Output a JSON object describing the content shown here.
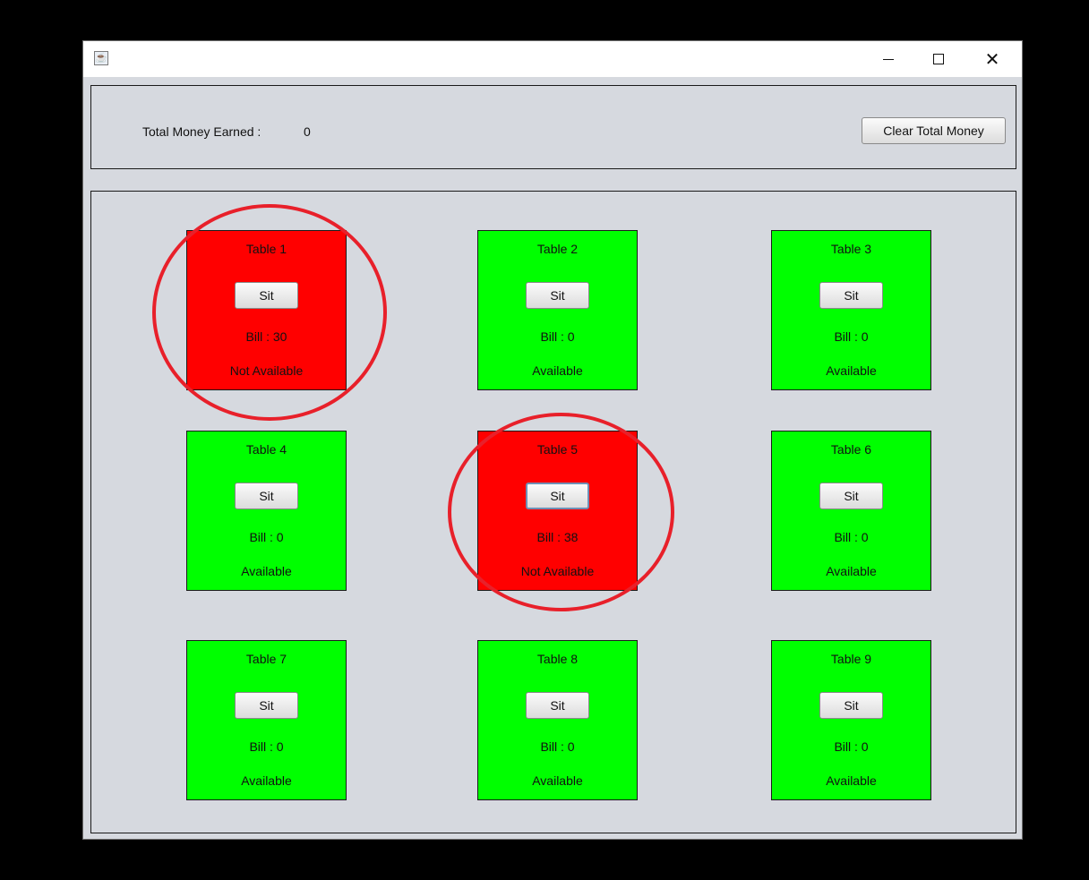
{
  "window": {
    "icon": "java-coffee-icon",
    "controls": {
      "minimize": "minimize-icon",
      "maximize": "maximize-icon",
      "close": "✕"
    }
  },
  "header": {
    "money_label": "Total Money Earned :",
    "money_value": "0",
    "clear_button": "Clear Total Money"
  },
  "tables": [
    {
      "name": "Table 1",
      "sit": "Sit",
      "bill": "Bill :  30",
      "status": "Not Available",
      "state": "occupied"
    },
    {
      "name": "Table 2",
      "sit": "Sit",
      "bill": "Bill :  0",
      "status": "Available",
      "state": "available"
    },
    {
      "name": "Table 3",
      "sit": "Sit",
      "bill": "Bill :  0",
      "status": "Available",
      "state": "available"
    },
    {
      "name": "Table 4",
      "sit": "Sit",
      "bill": "Bill :  0",
      "status": "Available",
      "state": "available"
    },
    {
      "name": "Table 5",
      "sit": "Sit",
      "bill": "Bill :  38",
      "status": "Not Available",
      "state": "occupied"
    },
    {
      "name": "Table 6",
      "sit": "Sit",
      "bill": "Bill :  0",
      "status": "Available",
      "state": "available"
    },
    {
      "name": "Table 7",
      "sit": "Sit",
      "bill": "Bill :  0",
      "status": "Available",
      "state": "available"
    },
    {
      "name": "Table 8",
      "sit": "Sit",
      "bill": "Bill :  0",
      "status": "Available",
      "state": "available"
    },
    {
      "name": "Table 9",
      "sit": "Sit",
      "bill": "Bill :  0",
      "status": "Available",
      "state": "available"
    }
  ],
  "colors": {
    "available": "#00ff00",
    "occupied": "#ff0000",
    "annotation": "#e8202a"
  }
}
